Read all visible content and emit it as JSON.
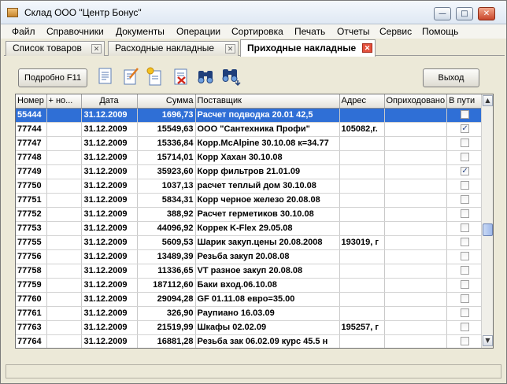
{
  "window": {
    "title": "Склад ООО \"Центр Бонус\"",
    "min_glyph": "—",
    "max_glyph": "□",
    "close_glyph": "✕"
  },
  "menu": [
    "Файл",
    "Справочники",
    "Документы",
    "Операции",
    "Сортировка",
    "Печать",
    "Отчеты",
    "Сервис",
    "Помощь"
  ],
  "tabs": [
    {
      "label": "Список товаров",
      "active": false
    },
    {
      "label": "Расходные накладные",
      "active": false
    },
    {
      "label": "Приходные накладные",
      "active": true
    }
  ],
  "tab_close_glyph": "✕",
  "toolbar": {
    "details_label": "Подробно F11",
    "exit_label": "Выход",
    "icons": [
      "document-icon",
      "edit-document-icon",
      "new-document-icon",
      "delete-document-icon",
      "find-icon",
      "find-next-icon"
    ]
  },
  "grid": {
    "columns": [
      "Номер",
      "+ но...",
      "Дата",
      "Сумма",
      "Поставщик",
      "Адрес",
      "Оприходовано",
      "В пути"
    ],
    "check_glyph": "✓",
    "rows": [
      {
        "number": "55444",
        "extra": "",
        "date": "31.12.2009",
        "sum": "1696,73",
        "supplier": "Расчет подводка 20.01 42,5",
        "address": "",
        "received": "",
        "in_transit": false,
        "selected": true
      },
      {
        "number": "77744",
        "extra": "",
        "date": "31.12.2009",
        "sum": "15549,63",
        "supplier": "ООО \"Сантехника Профи\"",
        "address": "105082,г.",
        "received": "",
        "in_transit": true,
        "selected": false
      },
      {
        "number": "77747",
        "extra": "",
        "date": "31.12.2009",
        "sum": "15336,84",
        "supplier": "Корр.McAlpine 30.10.08 к=34.77",
        "address": "",
        "received": "",
        "in_transit": false,
        "selected": false
      },
      {
        "number": "77748",
        "extra": "",
        "date": "31.12.2009",
        "sum": "15714,01",
        "supplier": "Корр Хахан 30.10.08",
        "address": "",
        "received": "",
        "in_transit": false,
        "selected": false
      },
      {
        "number": "77749",
        "extra": "",
        "date": "31.12.2009",
        "sum": "35923,60",
        "supplier": "Корр фильтров 21.01.09",
        "address": "",
        "received": "",
        "in_transit": true,
        "selected": false
      },
      {
        "number": "77750",
        "extra": "",
        "date": "31.12.2009",
        "sum": "1037,13",
        "supplier": "расчет теплый дом 30.10.08",
        "address": "",
        "received": "",
        "in_transit": false,
        "selected": false
      },
      {
        "number": "77751",
        "extra": "",
        "date": "31.12.2009",
        "sum": "5834,31",
        "supplier": "Корр черное железо 20.08.08",
        "address": "",
        "received": "",
        "in_transit": false,
        "selected": false
      },
      {
        "number": "77752",
        "extra": "",
        "date": "31.12.2009",
        "sum": "388,92",
        "supplier": "Расчет герметиков 30.10.08",
        "address": "",
        "received": "",
        "in_transit": false,
        "selected": false
      },
      {
        "number": "77753",
        "extra": "",
        "date": "31.12.2009",
        "sum": "44096,92",
        "supplier": "Коррек K-Flex 29.05.08",
        "address": "",
        "received": "",
        "in_transit": false,
        "selected": false
      },
      {
        "number": "77755",
        "extra": "",
        "date": "31.12.2009",
        "sum": "5609,53",
        "supplier": "Шарик закуп.цены 20.08.2008",
        "address": "193019, г",
        "received": "",
        "in_transit": false,
        "selected": false
      },
      {
        "number": "77756",
        "extra": "",
        "date": "31.12.2009",
        "sum": "13489,39",
        "supplier": "Резьба закуп  20.08.08",
        "address": "",
        "received": "",
        "in_transit": false,
        "selected": false
      },
      {
        "number": "77758",
        "extra": "",
        "date": "31.12.2009",
        "sum": "11336,65",
        "supplier": "VT разное закуп 20.08.08",
        "address": "",
        "received": "",
        "in_transit": false,
        "selected": false
      },
      {
        "number": "77759",
        "extra": "",
        "date": "31.12.2009",
        "sum": "187112,60",
        "supplier": "Баки вход.06.10.08",
        "address": "",
        "received": "",
        "in_transit": false,
        "selected": false
      },
      {
        "number": "77760",
        "extra": "",
        "date": "31.12.2009",
        "sum": "29094,28",
        "supplier": "GF 01.11.08 евро=35.00",
        "address": "",
        "received": "",
        "in_transit": false,
        "selected": false
      },
      {
        "number": "77761",
        "extra": "",
        "date": "31.12.2009",
        "sum": "326,90",
        "supplier": "Раупиано 16.03.09",
        "address": "",
        "received": "",
        "in_transit": false,
        "selected": false
      },
      {
        "number": "77763",
        "extra": "",
        "date": "31.12.2009",
        "sum": "21519,99",
        "supplier": "Шкафы 02.02.09",
        "address": "195257, г",
        "received": "",
        "in_transit": false,
        "selected": false
      },
      {
        "number": "77764",
        "extra": "",
        "date": "31.12.2009",
        "sum": "16881,28",
        "supplier": "Резьба зак 06.02.09 курс 45.5 н",
        "address": "",
        "received": "",
        "in_transit": false,
        "selected": false
      }
    ]
  },
  "scrollbar": {
    "up_glyph": "▲",
    "down_glyph": "▼"
  }
}
